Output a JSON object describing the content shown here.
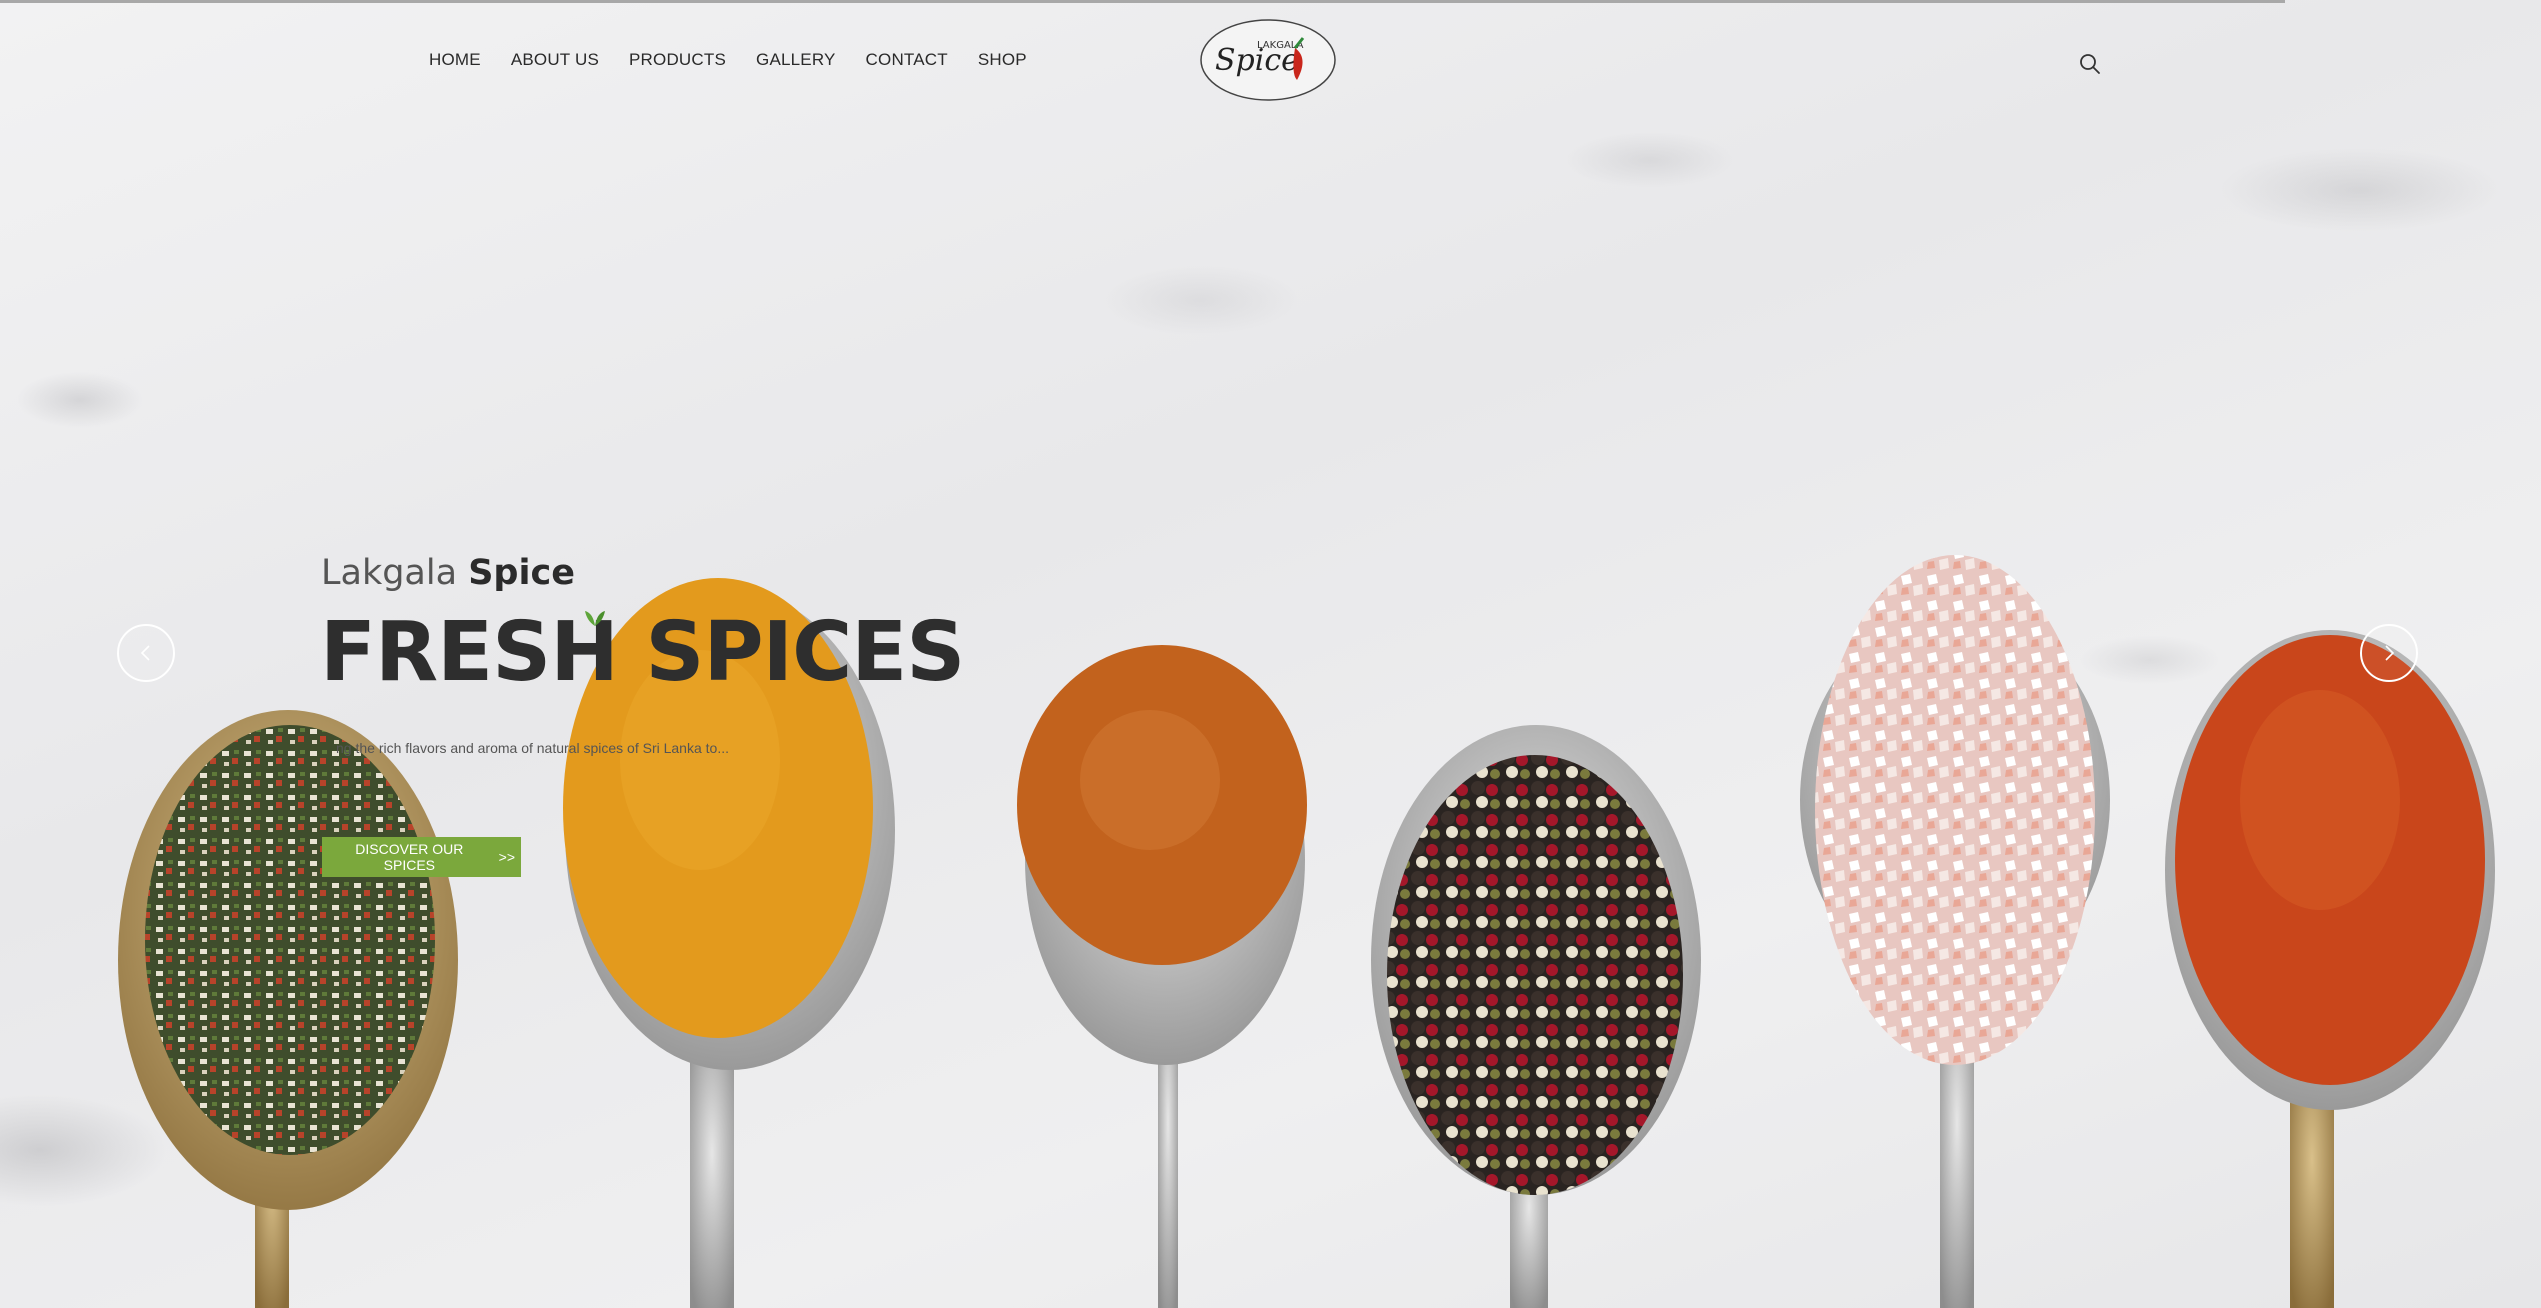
{
  "site": {
    "logo_text": "Lakgala Spice"
  },
  "nav": {
    "items": [
      {
        "label": "HOME"
      },
      {
        "label": "ABOUT US"
      },
      {
        "label": "PRODUCTS"
      },
      {
        "label": "GALLERY"
      },
      {
        "label": "CONTACT"
      },
      {
        "label": "SHOP"
      }
    ],
    "search_icon": "search-icon"
  },
  "hero": {
    "subtitle_light": "Lakgala",
    "subtitle_bold": "Spice",
    "headline": "FRESH SPICES",
    "tagline": "ng the rich flavors and aroma of natural spices of Sri Lanka to...",
    "cta_label": "DISCOVER OUR SPICES",
    "cta_suffix": ">>",
    "prev_icon": "chevron-left-icon",
    "next_icon": "chevron-right-icon"
  },
  "colors": {
    "accent": "#7ba83c",
    "text_dark": "#2e2e2e",
    "turmeric": "#e39a1d",
    "cinnamon": "#c2621d",
    "paprika": "#c9461b",
    "salt": "#f1d3cf"
  }
}
